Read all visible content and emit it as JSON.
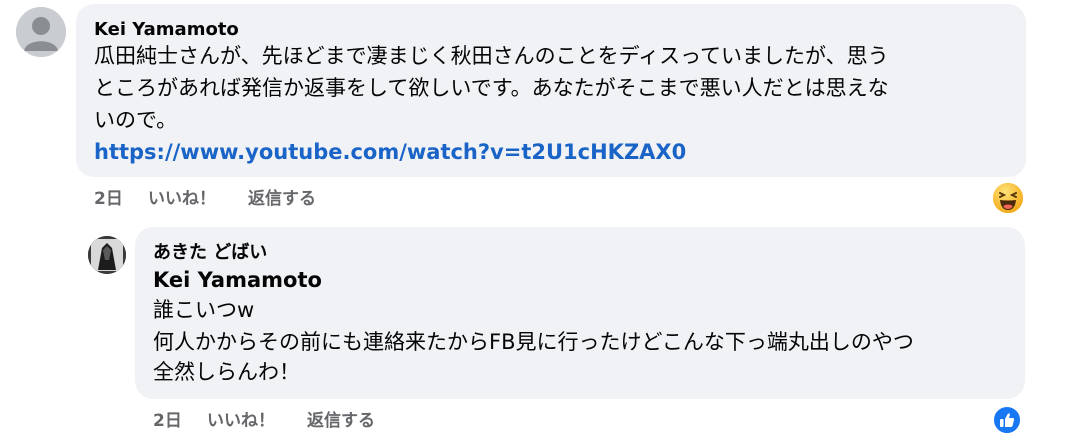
{
  "comments": [
    {
      "author": "Kei Yamamoto",
      "lines": [
        "瓜田純士さんが、先ほどまで凄まじく秋田さんのことをディスっていましたが、思う",
        "ところがあれば発信か返事をして欲しいです。あなたがそこまで悪い人だとは思えな",
        "いので。"
      ],
      "link": "https://www.youtube.com/watch?v=t2U1cHKZAX0",
      "time": "2日",
      "like_label": "いいね！",
      "reply_label": "返信する",
      "reaction_icon": "grinning-squint-emoji-icon"
    }
  ],
  "reply": {
    "author": "あきた どばい",
    "mention": "Kei Yamamoto",
    "lines": [
      "誰こいつw",
      "何人かからその前にも連絡来たからFB見に行ったけどこんな下っ端丸出しのやつ",
      "全然しらんわ！"
    ],
    "time": "2日",
    "like_label": "いいね！",
    "reply_label": "返信する",
    "reaction_icon": "like-thumbs-up-icon"
  },
  "colors": {
    "bubble": "#f0f2f5",
    "link": "#1a64c8",
    "meta": "#65676b",
    "like_blue": "#1877f2"
  }
}
